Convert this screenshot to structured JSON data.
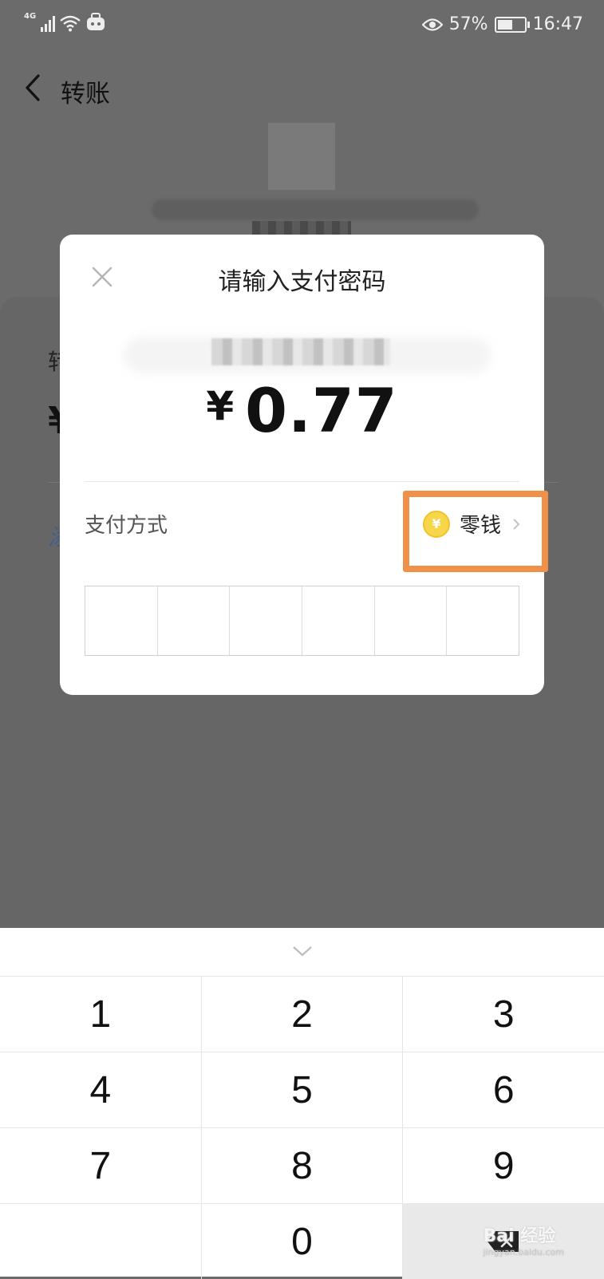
{
  "status_bar": {
    "network": "4G",
    "battery_percent": "57%",
    "battery_level": 0.57,
    "time": "16:47"
  },
  "nav": {
    "title": "转账"
  },
  "background": {
    "label_partial": "转",
    "amount_partial": "¥",
    "note_partial": "添"
  },
  "dialog": {
    "title": "请输入支付密码",
    "currency_symbol": "¥",
    "amount": "0.77",
    "payment_method_label": "支付方式",
    "payment_method_value": "零钱",
    "coin_symbol": "¥",
    "pin_length": 6
  },
  "keypad": {
    "keys": [
      "1",
      "2",
      "3",
      "4",
      "5",
      "6",
      "7",
      "8",
      "9",
      "",
      "0",
      "delete"
    ]
  },
  "watermark": {
    "text": "Bai 经验",
    "url": "jingyan.baidu.com"
  },
  "colors": {
    "highlight": "#f0914a",
    "overlay": "#6b6b6b",
    "coin": "#f7d64a"
  }
}
